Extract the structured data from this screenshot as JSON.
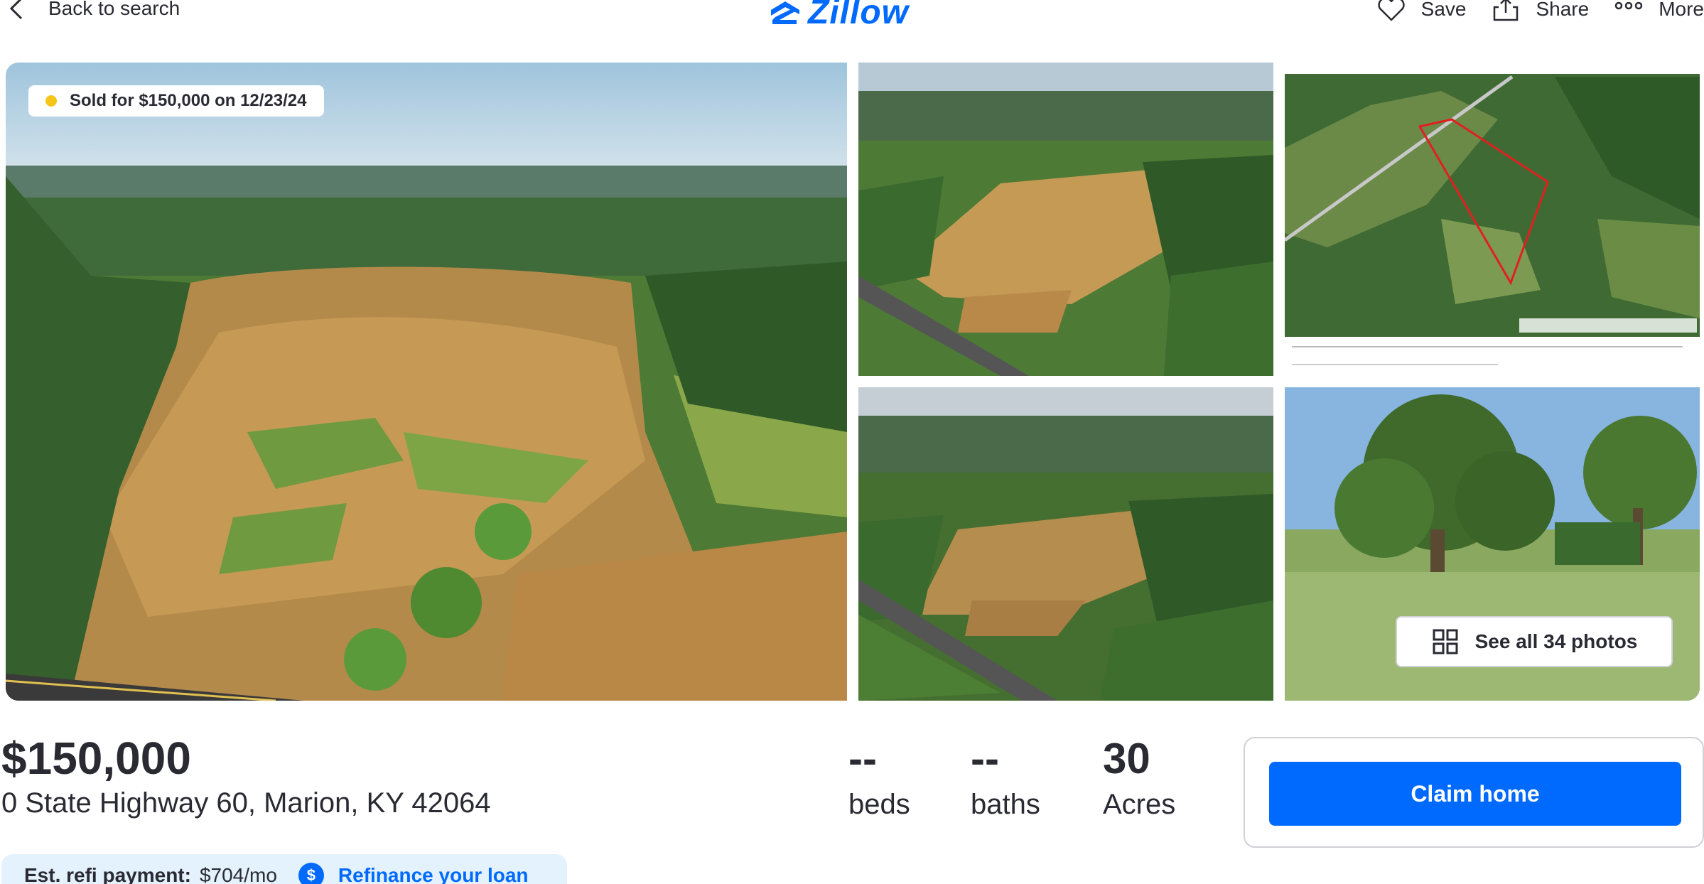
{
  "header": {
    "back_label": "Back to search",
    "logo_text": "Zillow",
    "save_label": "Save",
    "share_label": "Share",
    "more_label": "More"
  },
  "gallery": {
    "sold_badge": "Sold for $150,000 on 12/23/24",
    "see_all_label": "See all 34 photos",
    "photos": [
      "aerial-field",
      "aerial-field-road",
      "parcel-map",
      "aerial-field-road-2",
      "meadow-trees"
    ]
  },
  "summary": {
    "price": "$150,000",
    "address": "0 State Highway 60, Marion, KY 42064",
    "beds_value": "--",
    "beds_label": "beds",
    "baths_value": "--",
    "baths_label": "baths",
    "acres_value": "30",
    "acres_label": "Acres"
  },
  "claim": {
    "button_label": "Claim home"
  },
  "refi": {
    "label": "Est. refi payment:",
    "value": "$704/mo",
    "dollar_icon": "$",
    "link": "Refinance your loan"
  },
  "colors": {
    "brand": "#006aff",
    "sold_dot": "#f5c518",
    "refi_bg": "#e3f2fd"
  }
}
